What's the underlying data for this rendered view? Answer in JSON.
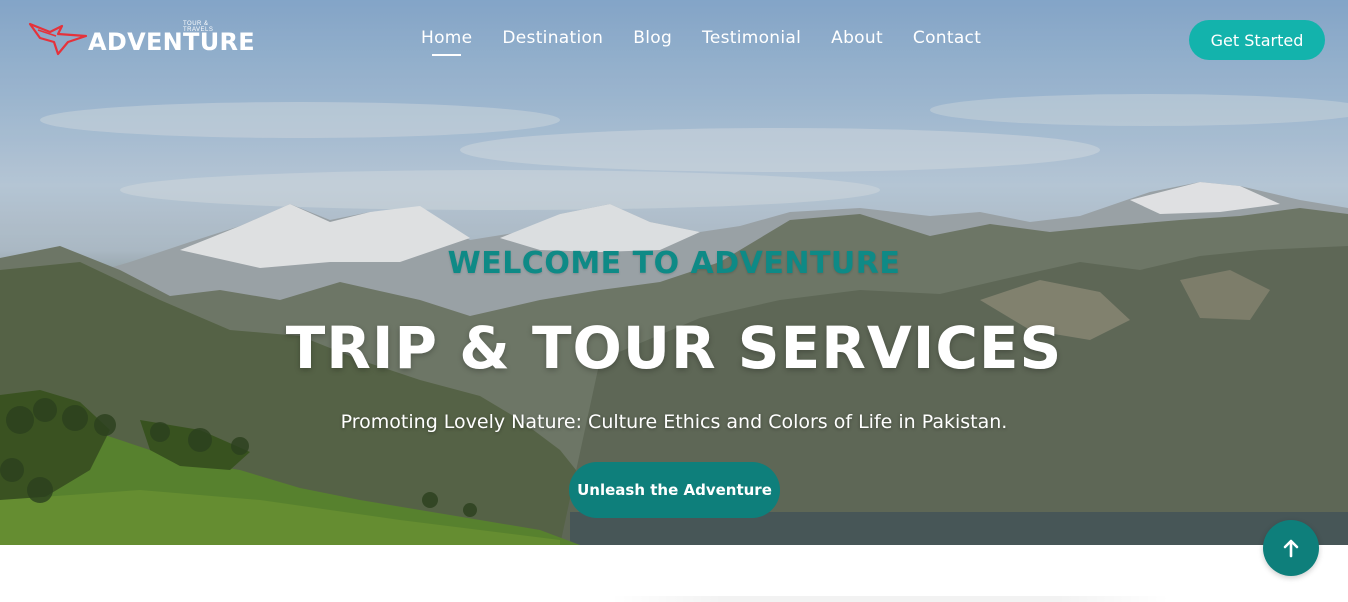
{
  "brand": {
    "name": "ADVENTURE",
    "tagline": "TOUR & TRAVELS",
    "accent": "#e5323b"
  },
  "nav": {
    "items": [
      {
        "label": "Home",
        "active": true
      },
      {
        "label": "Destination",
        "active": false
      },
      {
        "label": "Blog",
        "active": false
      },
      {
        "label": "Testimonial",
        "active": false
      },
      {
        "label": "About",
        "active": false
      },
      {
        "label": "Contact",
        "active": false
      }
    ],
    "cta_label": "Get Started"
  },
  "hero": {
    "eyebrow": "WELCOME TO ADVENTURE",
    "title": "TRIP & TOUR SERVICES",
    "subtitle": "Promoting Lovely Nature: Culture Ethics and Colors of Life in Pakistan.",
    "cta_label": "Unleash the Adventure"
  },
  "scroll_top": {
    "icon": "arrow-up-icon"
  },
  "colors": {
    "teal": "#13b3ac",
    "teal_dark": "#0e7f7b",
    "eyebrow": "#0e8a86"
  }
}
